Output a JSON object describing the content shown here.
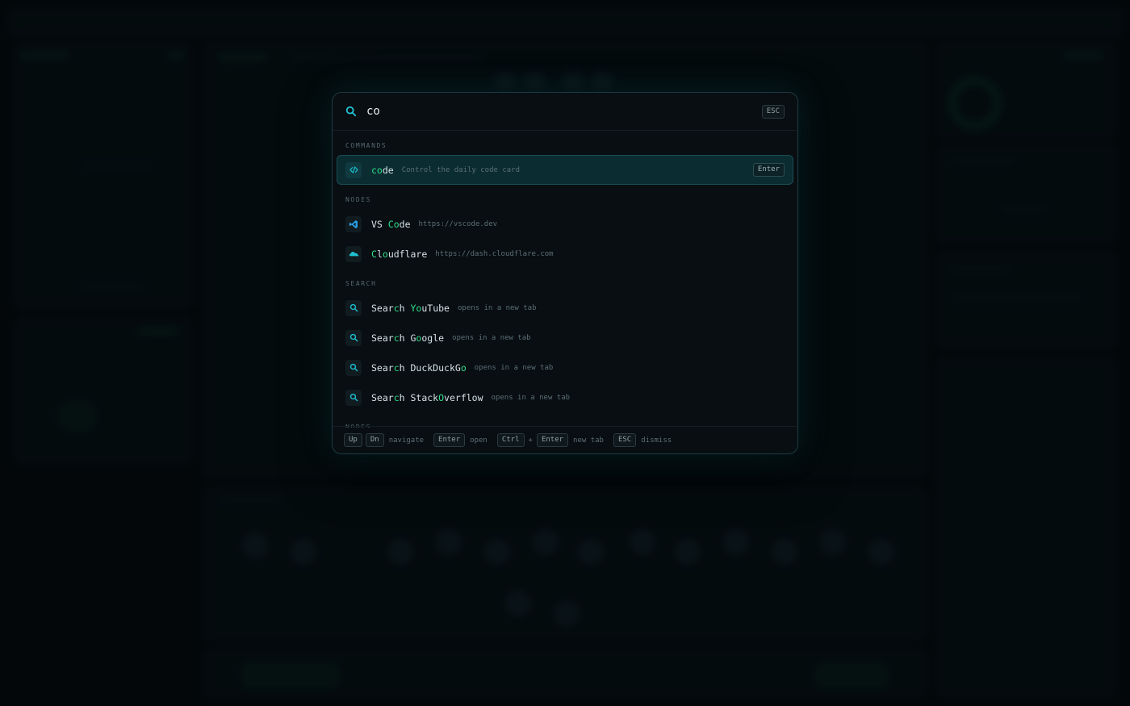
{
  "search": {
    "query": "co",
    "esc_label": "ESC"
  },
  "sections": [
    {
      "label": "COMMANDS",
      "items": [
        {
          "icon": "code-icon",
          "title_parts": [
            [
              "co",
              true
            ],
            [
              "de",
              false
            ]
          ],
          "sub": "Control the daily code card",
          "kbd": "Enter",
          "active": true
        }
      ]
    },
    {
      "label": "NODES",
      "items": [
        {
          "icon": "vscode-icon",
          "title_parts": [
            [
              "VS ",
              false
            ],
            [
              "Co",
              true
            ],
            [
              "de",
              false
            ]
          ],
          "sub": "https://vscode.dev"
        },
        {
          "icon": "cloudflare-icon",
          "title_parts": [
            [
              "C",
              true
            ],
            [
              "l",
              false
            ],
            [
              "o",
              true
            ],
            [
              "udflare",
              false
            ]
          ],
          "sub": "https://dash.cloudflare.com"
        }
      ]
    },
    {
      "label": "SEARCH",
      "items": [
        {
          "icon": "search-icon",
          "title_parts": [
            [
              "Sear",
              false
            ],
            [
              "c",
              true
            ],
            [
              "h ",
              false
            ],
            [
              "Yo",
              true
            ],
            [
              "uTube",
              false
            ]
          ],
          "sub": "opens in a new tab"
        },
        {
          "icon": "search-icon",
          "title_parts": [
            [
              "Sear",
              false
            ],
            [
              "c",
              true
            ],
            [
              "h G",
              false
            ],
            [
              "o",
              true
            ],
            [
              "ogle",
              false
            ]
          ],
          "sub": "opens in a new tab"
        },
        {
          "icon": "search-icon",
          "title_parts": [
            [
              "Sear",
              false
            ],
            [
              "c",
              true
            ],
            [
              "h DuckDuckG",
              false
            ],
            [
              "o",
              true
            ]
          ],
          "sub": "opens in a new tab"
        },
        {
          "icon": "search-icon",
          "title_parts": [
            [
              "Sear",
              false
            ],
            [
              "c",
              true
            ],
            [
              "h Stack",
              false
            ],
            [
              "O",
              true
            ],
            [
              "verflow",
              false
            ]
          ],
          "sub": "opens in a new tab"
        }
      ]
    },
    {
      "label": "NODES",
      "items": []
    }
  ],
  "footer": {
    "up": "Up",
    "dn": "Dn",
    "navigate": "navigate",
    "enter": "Enter",
    "open": "open",
    "ctrl": "Ctrl",
    "plus": "+",
    "enter2": "Enter",
    "new_tab": "new tab",
    "esc": "ESC",
    "dismiss": "dismiss"
  },
  "colors": {
    "accent": "#22c7d8",
    "match": "#2ee08c",
    "active_bg": "#0b2c31"
  }
}
